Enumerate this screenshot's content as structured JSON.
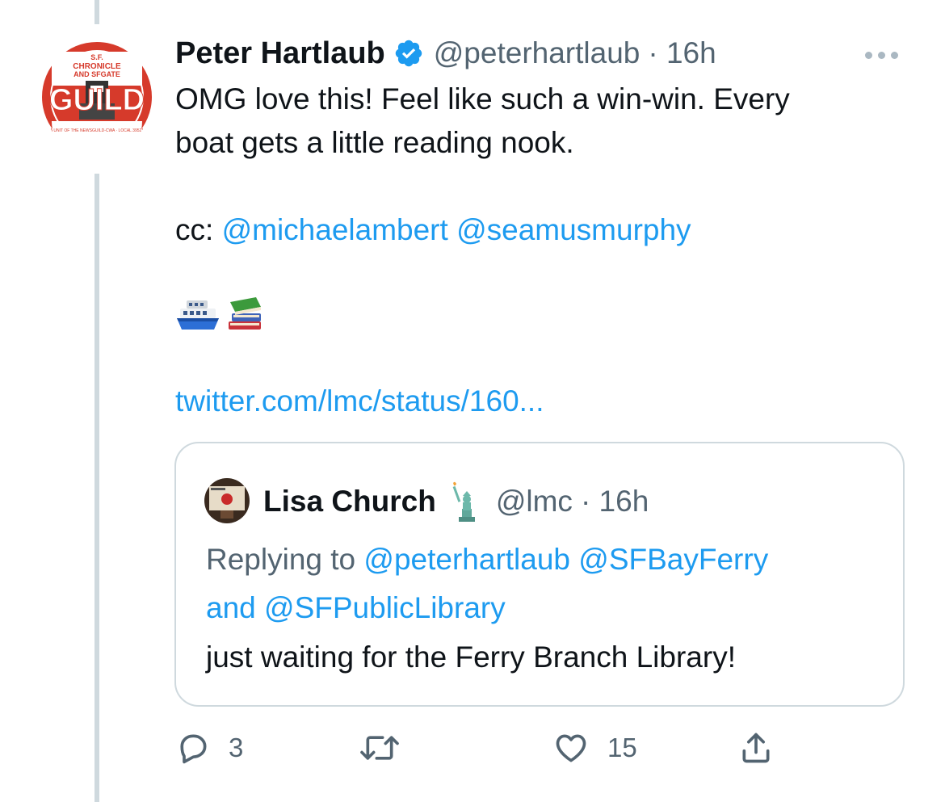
{
  "colors": {
    "link": "#1d9bf0",
    "secondary": "#536471",
    "verified": "#1d9bf0",
    "border": "#cfd9de"
  },
  "tweet": {
    "author_name": "Peter Hartlaub",
    "author_handle": "@peterhartlaub",
    "time": "· 16h",
    "avatar": {
      "icon": "guild-logo-icon",
      "logo_text": [
        "S.F.",
        "CHRONICLE",
        "AND SFGATE",
        "GUILD",
        "A UNIT OF THE NEWSGUILD-CWA · LOCAL 39521"
      ]
    },
    "line1": "OMG love this! Feel like such a win-win. Every",
    "line2": "boat gets a little reading nook.",
    "cc_label": "cc: ",
    "mention1": "@michaelambert",
    "mention2": "@seamusmurphy",
    "emojis": [
      "ferry-emoji-icon",
      "books-emoji-icon"
    ],
    "card_link": "twitter.com/lmc/status/160..."
  },
  "quote": {
    "author_name": "Lisa Church",
    "author_handle": "@lmc",
    "time": "· 16h",
    "replying_prefix": "Replying to",
    "reply_to1": "@peterhartlaub",
    "reply_to2": "@SFBayFerry",
    "and": "and",
    "reply_to3": "@SFPublicLibrary",
    "text": "just waiting for the Ferry Branch Library!"
  },
  "actions": {
    "replies": "3",
    "retweets": "",
    "likes": "15"
  }
}
